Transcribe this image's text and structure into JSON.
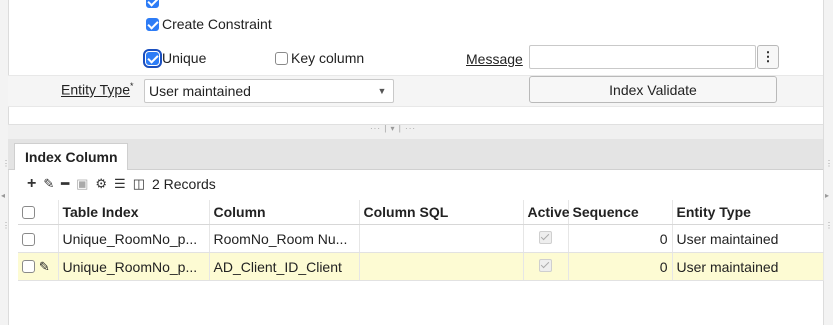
{
  "form": {
    "create_constraint_label": "Create Constraint",
    "unique_label": "Unique",
    "key_column_label": "Key column",
    "message_label": "Message",
    "message_value": "",
    "entity_type_label": "Entity Type",
    "required_mark": "*",
    "entity_type_value": "User maintained",
    "index_validate_label": "Index Validate",
    "create_constraint_checked": true,
    "unique_checked": true,
    "key_column_checked": false
  },
  "tabs": [
    {
      "label": "Index Column"
    }
  ],
  "toolbar": {
    "records_label": "2 Records"
  },
  "grid": {
    "columns": [
      "Table Index",
      "Column",
      "Column SQL",
      "Active",
      "Sequence",
      "Entity Type"
    ],
    "rows": [
      {
        "table_index": "Unique_RoomNo_p...",
        "column": "RoomNo_Room Nu...",
        "column_sql": "",
        "active": true,
        "sequence": "0",
        "entity_type": "User maintained"
      },
      {
        "table_index": "Unique_RoomNo_p...",
        "column": "AD_Client_ID_Client",
        "column_sql": "",
        "active": true,
        "sequence": "0",
        "entity_type": "User maintained"
      }
    ]
  },
  "colors": {
    "accent": "#2d7cf6",
    "selected_row": "#fdfbd3"
  }
}
